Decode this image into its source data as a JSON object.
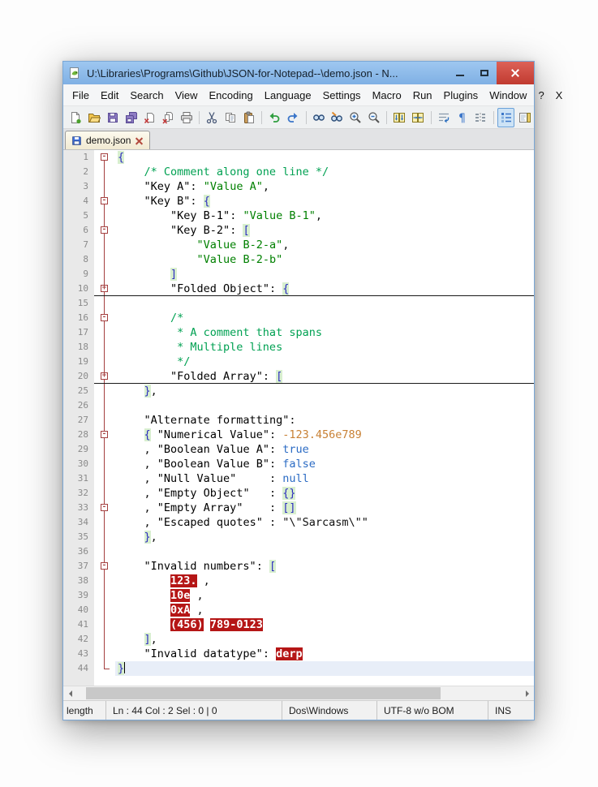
{
  "window": {
    "title": "U:\\Libraries\\Programs\\Github\\JSON-for-Notepad--\\demo.json - N..."
  },
  "menu": {
    "items": [
      "File",
      "Edit",
      "Search",
      "View",
      "Encoding",
      "Language",
      "Settings",
      "Macro",
      "Run",
      "Plugins",
      "Window",
      "?",
      "X"
    ]
  },
  "toolbar": {
    "active": "function-list",
    "groups": [
      [
        "new-file",
        "open-file",
        "save",
        "save-all",
        "close-file",
        "close-all",
        "print"
      ],
      [
        "cut",
        "copy",
        "paste"
      ],
      [
        "undo",
        "redo"
      ],
      [
        "find",
        "replace",
        "zoom-in",
        "zoom-out"
      ],
      [
        "sync-vertical",
        "sync-horizontal"
      ],
      [
        "word-wrap",
        "show-all-characters",
        "indent-guide"
      ],
      [
        "function-list",
        "document-map"
      ]
    ]
  },
  "tabs": [
    {
      "label": "demo.json",
      "active": true,
      "saved": true
    }
  ],
  "editor": {
    "colors": {
      "comment": "#00a152",
      "string": "#008000",
      "number": "#c88135",
      "keyword": "#2b6bc4",
      "brace": "#2d2dc0",
      "brace_highlight_bg": "#d8efcf",
      "invalid_bg": "#b51616",
      "current_line_bg": "#e8eef8",
      "fold_marker": "#a43f3f"
    },
    "lines": [
      {
        "n": 1,
        "fold": "open-first",
        "segs": [
          [
            "brace",
            "{"
          ]
        ]
      },
      {
        "n": 2,
        "fold": "line",
        "segs": [
          [
            "comment",
            "    /* Comment along one line */"
          ]
        ]
      },
      {
        "n": 3,
        "fold": "line",
        "segs": [
          [
            "plain",
            "    "
          ],
          [
            "key",
            "\"Key A\""
          ],
          [
            "plain",
            ": "
          ],
          [
            "str",
            "\"Value A\""
          ],
          [
            "plain",
            ","
          ]
        ]
      },
      {
        "n": 4,
        "fold": "open",
        "segs": [
          [
            "plain",
            "    "
          ],
          [
            "key",
            "\"Key B\""
          ],
          [
            "plain",
            ": "
          ],
          [
            "brace",
            "{"
          ]
        ]
      },
      {
        "n": 5,
        "fold": "line",
        "segs": [
          [
            "plain",
            "        "
          ],
          [
            "key",
            "\"Key B-1\""
          ],
          [
            "plain",
            ": "
          ],
          [
            "str",
            "\"Value B-1\""
          ],
          [
            "plain",
            ","
          ]
        ]
      },
      {
        "n": 6,
        "fold": "open",
        "segs": [
          [
            "plain",
            "        "
          ],
          [
            "key",
            "\"Key B-2\""
          ],
          [
            "plain",
            ": "
          ],
          [
            "brace",
            "["
          ]
        ]
      },
      {
        "n": 7,
        "fold": "line",
        "segs": [
          [
            "plain",
            "            "
          ],
          [
            "str",
            "\"Value B-2-a\""
          ],
          [
            "plain",
            ","
          ]
        ]
      },
      {
        "n": 8,
        "fold": "line",
        "segs": [
          [
            "plain",
            "            "
          ],
          [
            "str",
            "\"Value B-2-b\""
          ]
        ]
      },
      {
        "n": 9,
        "fold": "line",
        "segs": [
          [
            "plain",
            "        "
          ],
          [
            "brace",
            "]"
          ]
        ]
      },
      {
        "n": 10,
        "fold": "folded",
        "rule": true,
        "segs": [
          [
            "plain",
            "        "
          ],
          [
            "key",
            "\"Folded Object\""
          ],
          [
            "plain",
            ": "
          ],
          [
            "brace",
            "{"
          ]
        ]
      },
      {
        "n": 15,
        "fold": "line",
        "segs": []
      },
      {
        "n": 16,
        "fold": "open",
        "segs": [
          [
            "comment",
            "        /*"
          ]
        ]
      },
      {
        "n": 17,
        "fold": "line",
        "segs": [
          [
            "comment",
            "         * A comment that spans"
          ]
        ]
      },
      {
        "n": 18,
        "fold": "line",
        "segs": [
          [
            "comment",
            "         * Multiple lines"
          ]
        ]
      },
      {
        "n": 19,
        "fold": "line",
        "segs": [
          [
            "comment",
            "         */"
          ]
        ]
      },
      {
        "n": 20,
        "fold": "folded",
        "rule": true,
        "segs": [
          [
            "plain",
            "        "
          ],
          [
            "key",
            "\"Folded Array\""
          ],
          [
            "plain",
            ": "
          ],
          [
            "brace",
            "["
          ]
        ]
      },
      {
        "n": 25,
        "fold": "line",
        "segs": [
          [
            "plain",
            "    "
          ],
          [
            "brace",
            "}"
          ],
          [
            "plain",
            ","
          ]
        ]
      },
      {
        "n": 26,
        "fold": "line",
        "segs": []
      },
      {
        "n": 27,
        "fold": "line",
        "segs": [
          [
            "plain",
            "    "
          ],
          [
            "key",
            "\"Alternate formatting\""
          ],
          [
            "plain",
            ":"
          ]
        ]
      },
      {
        "n": 28,
        "fold": "open",
        "segs": [
          [
            "plain",
            "    "
          ],
          [
            "brace",
            "{"
          ],
          [
            "plain",
            " "
          ],
          [
            "key",
            "\"Numerical Value\""
          ],
          [
            "plain",
            ": "
          ],
          [
            "num",
            "-123.456e789"
          ]
        ]
      },
      {
        "n": 29,
        "fold": "line",
        "segs": [
          [
            "plain",
            "    , "
          ],
          [
            "key",
            "\"Boolean Value A\""
          ],
          [
            "plain",
            ": "
          ],
          [
            "kw",
            "true"
          ]
        ]
      },
      {
        "n": 30,
        "fold": "line",
        "segs": [
          [
            "plain",
            "    , "
          ],
          [
            "key",
            "\"Boolean Value B\""
          ],
          [
            "plain",
            ": "
          ],
          [
            "kw",
            "false"
          ]
        ]
      },
      {
        "n": 31,
        "fold": "line",
        "segs": [
          [
            "plain",
            "    , "
          ],
          [
            "key",
            "\"Null Value\""
          ],
          [
            "plain",
            "     : "
          ],
          [
            "kw",
            "null"
          ]
        ]
      },
      {
        "n": 32,
        "fold": "line",
        "segs": [
          [
            "plain",
            "    , "
          ],
          [
            "key",
            "\"Empty Object\""
          ],
          [
            "plain",
            "   : "
          ],
          [
            "brace",
            "{}"
          ]
        ]
      },
      {
        "n": 33,
        "fold": "open",
        "segs": [
          [
            "plain",
            "    , "
          ],
          [
            "key",
            "\"Empty Array\""
          ],
          [
            "plain",
            "    : "
          ],
          [
            "brace",
            "[]"
          ]
        ]
      },
      {
        "n": 34,
        "fold": "line",
        "segs": [
          [
            "plain",
            "    , "
          ],
          [
            "key",
            "\"Escaped quotes\""
          ],
          [
            "plain",
            " : "
          ],
          [
            "plain",
            "\"\\\"Sarcasm\\\"\""
          ]
        ]
      },
      {
        "n": 35,
        "fold": "line",
        "segs": [
          [
            "plain",
            "    "
          ],
          [
            "brace",
            "}"
          ],
          [
            "plain",
            ","
          ]
        ]
      },
      {
        "n": 36,
        "fold": "line",
        "segs": []
      },
      {
        "n": 37,
        "fold": "open",
        "segs": [
          [
            "plain",
            "    "
          ],
          [
            "key",
            "\"Invalid numbers\""
          ],
          [
            "plain",
            ": "
          ],
          [
            "brace",
            "["
          ]
        ]
      },
      {
        "n": 38,
        "fold": "line",
        "segs": [
          [
            "plain",
            "        "
          ],
          [
            "invalid",
            "123."
          ],
          [
            "plain",
            " ,"
          ]
        ]
      },
      {
        "n": 39,
        "fold": "line",
        "segs": [
          [
            "plain",
            "        "
          ],
          [
            "invalid",
            "10e"
          ],
          [
            "plain",
            " ,"
          ]
        ]
      },
      {
        "n": 40,
        "fold": "line",
        "segs": [
          [
            "plain",
            "        "
          ],
          [
            "invalid",
            "0xA"
          ],
          [
            "plain",
            " ,"
          ]
        ]
      },
      {
        "n": 41,
        "fold": "line",
        "segs": [
          [
            "plain",
            "        "
          ],
          [
            "invalid",
            "(456)"
          ],
          [
            "plain",
            " "
          ],
          [
            "invalid",
            "789-0123"
          ]
        ]
      },
      {
        "n": 42,
        "fold": "line",
        "segs": [
          [
            "plain",
            "    "
          ],
          [
            "brace",
            "]"
          ],
          [
            "plain",
            ","
          ]
        ]
      },
      {
        "n": 43,
        "fold": "line",
        "segs": [
          [
            "plain",
            "    "
          ],
          [
            "key",
            "\"Invalid datatype\""
          ],
          [
            "plain",
            ": "
          ],
          [
            "invalid",
            "derp"
          ]
        ]
      },
      {
        "n": 44,
        "fold": "end",
        "cur": true,
        "segs": [
          [
            "brace",
            "}"
          ]
        ]
      }
    ]
  },
  "status_bar": {
    "length_info": "length",
    "cursor_info": "Ln : 44    Col : 2    Sel : 0 | 0",
    "eol_format": "Dos\\Windows",
    "encoding": "UTF-8 w/o BOM",
    "typing_mode": "INS"
  }
}
